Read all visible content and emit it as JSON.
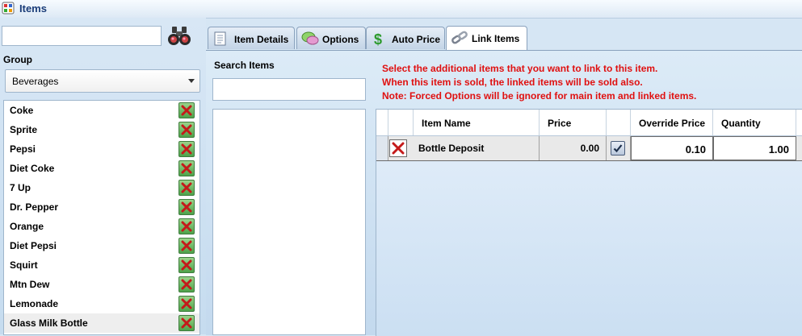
{
  "window": {
    "title": "Items",
    "icon": "items-app-icon"
  },
  "left_panel": {
    "search_value": "",
    "search_icon": "binoculars-icon",
    "group_label": "Group",
    "group_selected": "Beverages",
    "items": [
      {
        "label": "Coke"
      },
      {
        "label": "Sprite"
      },
      {
        "label": "Pepsi"
      },
      {
        "label": "Diet Coke"
      },
      {
        "label": "7 Up"
      },
      {
        "label": "Dr. Pepper"
      },
      {
        "label": "Orange"
      },
      {
        "label": "Diet Pepsi"
      },
      {
        "label": "Squirt"
      },
      {
        "label": "Mtn Dew"
      },
      {
        "label": "Lemonade"
      },
      {
        "label": "Glass Milk Bottle"
      }
    ],
    "selected_index": 11
  },
  "tabs": [
    {
      "label": "Item Details",
      "icon": "document-icon",
      "active": false
    },
    {
      "label": "Options",
      "icon": "speech-bubble-icon",
      "active": false
    },
    {
      "label": "Auto Price",
      "icon": "dollar-icon",
      "active": false
    },
    {
      "label": "Link Items",
      "icon": "chain-link-icon",
      "active": true
    }
  ],
  "link_items": {
    "search_label": "Search Items",
    "search_value": "",
    "instructions": [
      "Select the additional items that you want to link to this item.",
      "When this item is sold, the linked items will be sold also.",
      "Note: Forced Options will be ignored for main item and linked items."
    ],
    "columns": [
      "Item Name",
      "Price",
      "Override Price",
      "Quantity"
    ],
    "rows": [
      {
        "name": "Bottle Deposit",
        "price": "0.00",
        "override_checked": true,
        "override_price": "0.10",
        "quantity": "1.00"
      }
    ]
  },
  "colors": {
    "instruction_text": "#e01010",
    "accent": "#1a3c78"
  }
}
